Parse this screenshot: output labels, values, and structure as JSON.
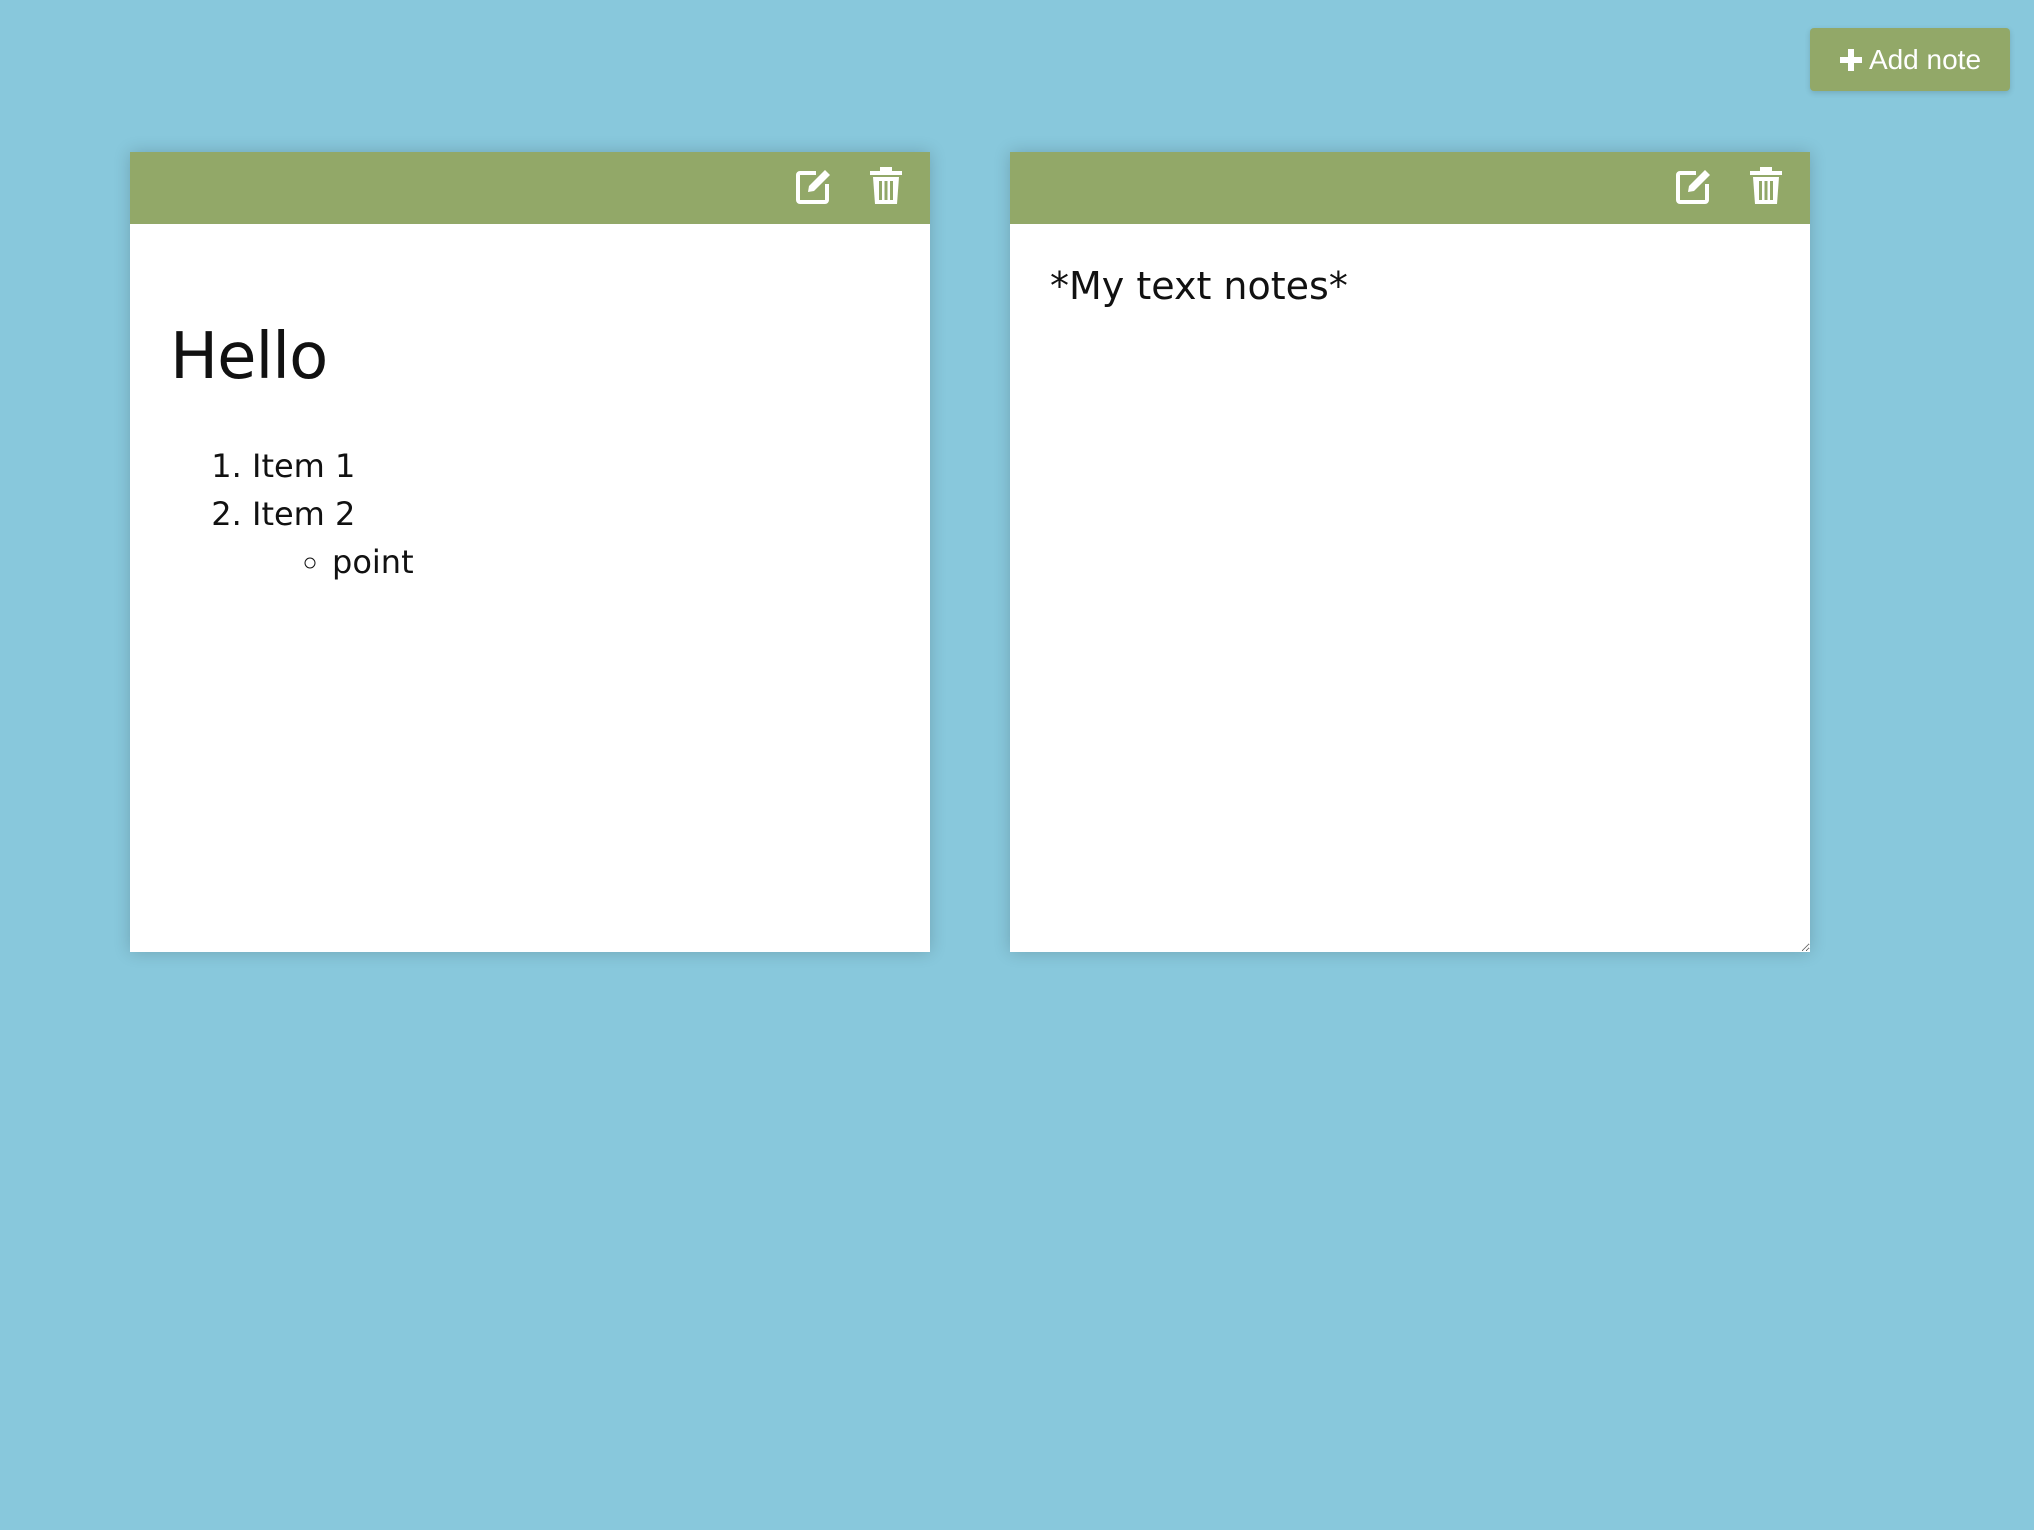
{
  "header": {
    "add_note_label": "Add note",
    "add_icon": "plus-icon"
  },
  "colors": {
    "background": "#88c8dc",
    "accent": "#92a868",
    "note": "#ffffff"
  },
  "notes": [
    {
      "mode": "preview",
      "icons": [
        "edit-icon",
        "trash-icon"
      ],
      "heading": "Hello",
      "ordered_items": [
        "Item 1",
        "Item 2"
      ],
      "sub_items": [
        "point"
      ]
    },
    {
      "mode": "edit",
      "icons": [
        "edit-icon",
        "trash-icon"
      ],
      "text": "*My text notes*"
    }
  ]
}
